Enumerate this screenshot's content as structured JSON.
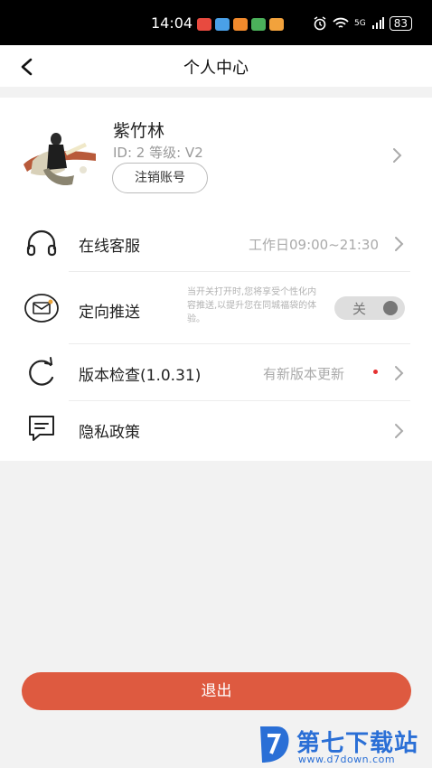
{
  "status_bar": {
    "time": "14:04",
    "network": "5G",
    "battery": "83"
  },
  "header": {
    "title": "个人中心"
  },
  "profile": {
    "name": "紫竹林",
    "meta": "ID: 2 等级:  V2",
    "cancel_account_label": "注销账号"
  },
  "menu": {
    "service": {
      "label": "在线客服",
      "value": "工作日09:00~21:30"
    },
    "push": {
      "label": "定向推送",
      "description": "当开关打开时,您将享受个性化内容推送,以提升您在同城福袋的体验。",
      "toggle_label": "关",
      "enabled": false
    },
    "version": {
      "label": "版本检查(1.0.31)",
      "value": "有新版本更新"
    },
    "privacy": {
      "label": "隐私政策"
    }
  },
  "logout_label": "退出",
  "watermark": {
    "title": "第七下载站",
    "url": "www.d7down.com"
  },
  "colors": {
    "accent": "#de5a40",
    "page_bg": "#f2f2f2",
    "watermark": "#2a6fd6"
  }
}
